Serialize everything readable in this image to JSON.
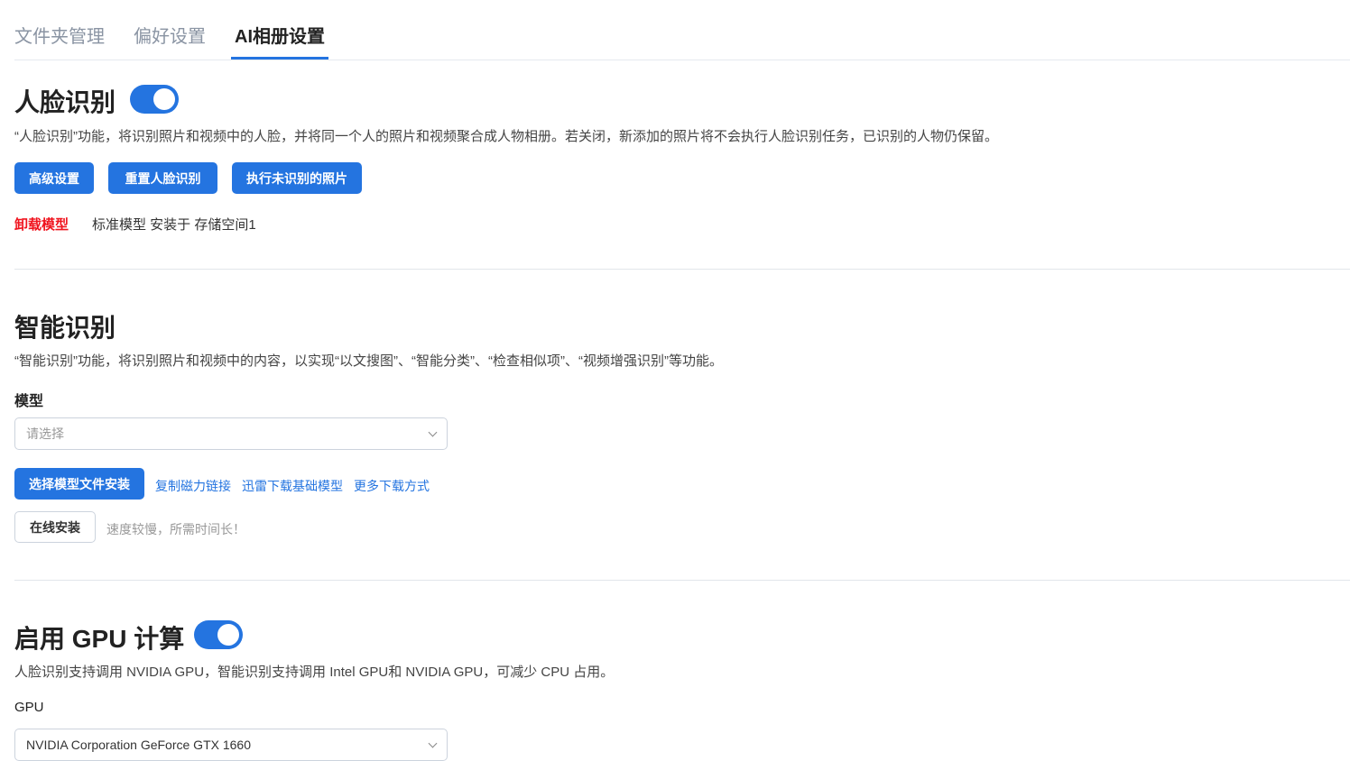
{
  "tabs": [
    "文件夹管理",
    "偏好设置",
    "AI相册设置"
  ],
  "face": {
    "title": "人脸识别",
    "enabled": true,
    "desc": "“人脸识别”功能，将识别照片和视频中的人脸，并将同一个人的照片和视频聚合成人物相册。若关闭，新添加的照片将不会执行人脸识别任务，已识别的人物仍保留。",
    "buttons": [
      "高级设置",
      "重置人脸识别",
      "执行未识别的照片"
    ],
    "uninstall": "卸载模型",
    "model_info": "标准模型 安装于 存储空间1"
  },
  "smart": {
    "title": "智能识别",
    "desc": "“智能识别”功能，将识别照片和视频中的内容，以实现“以文搜图”、“智能分类”、“检查相似项”、“视频增强识别”等功能。",
    "model_label": "模型",
    "select_placeholder": "请选择",
    "install_button": "选择模型文件安装",
    "links": [
      "复制磁力链接",
      "迅雷下载基础模型",
      "更多下载方式"
    ],
    "online_button": "在线安装",
    "online_hint": "速度较慢，所需时间长！"
  },
  "gpu": {
    "title": "启用 GPU 计算",
    "enabled": true,
    "desc": "人脸识别支持调用 NVIDIA GPU，智能识别支持调用 Intel GPU和 NVIDIA GPU，可减少 CPU 占用。",
    "label": "GPU",
    "selected": "NVIDIA Corporation GeForce GTX 1660"
  }
}
